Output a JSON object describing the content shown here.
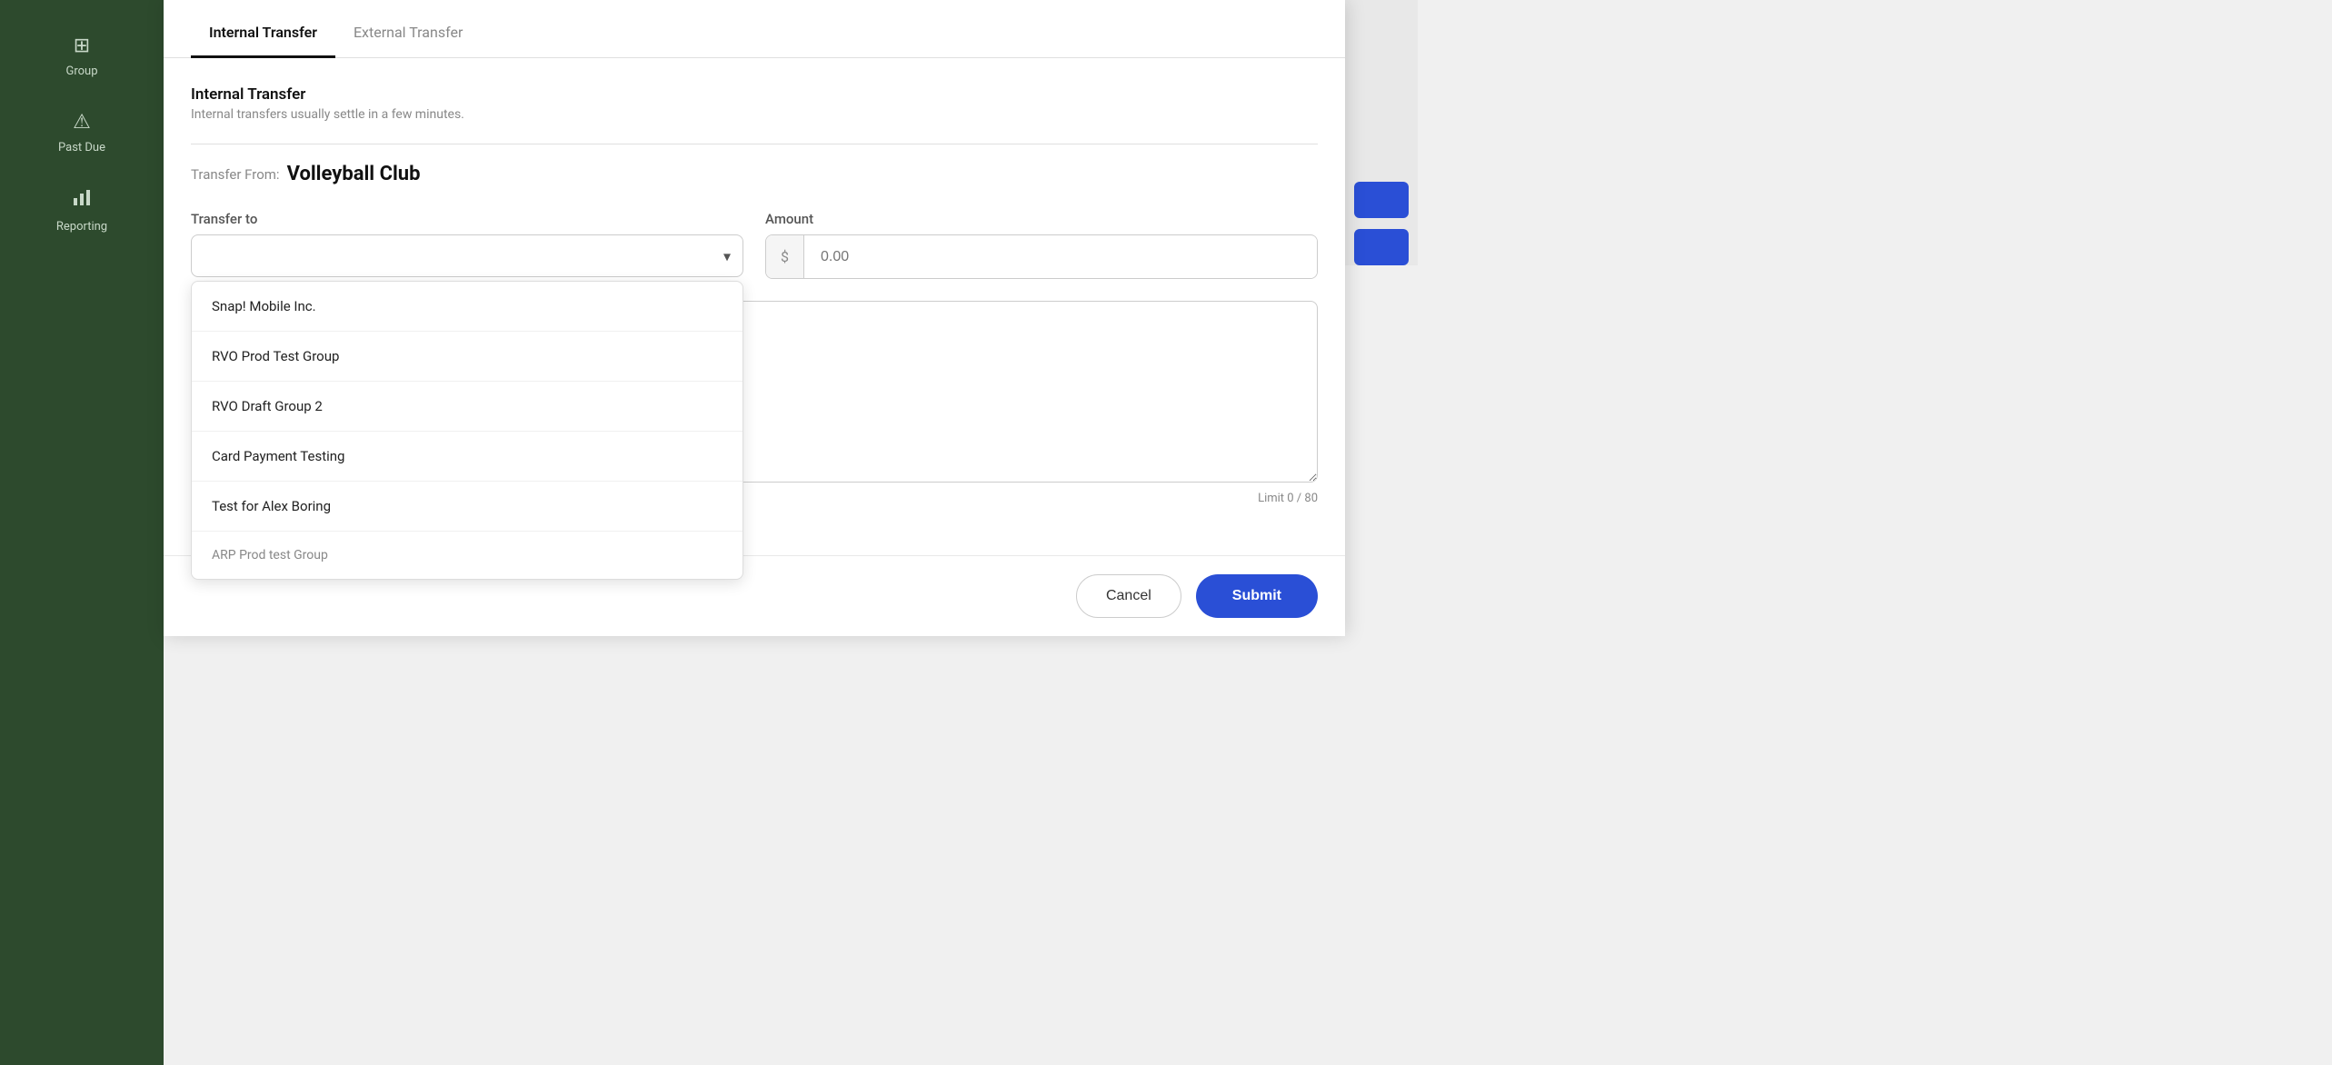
{
  "sidebar": {
    "items": [
      {
        "id": "group",
        "label": "Group",
        "icon": "⊞"
      },
      {
        "id": "past-due",
        "label": "Past Due",
        "icon": "⚠"
      },
      {
        "id": "reporting",
        "label": "Reporting",
        "icon": "📊"
      }
    ]
  },
  "modal": {
    "tabs": [
      {
        "id": "internal",
        "label": "Internal Transfer",
        "active": true
      },
      {
        "id": "external",
        "label": "External Transfer",
        "active": false
      }
    ],
    "section_title": "Internal Transfer",
    "section_subtitle": "Internal transfers usually settle in a few minutes.",
    "transfer_from_label": "Transfer From:",
    "transfer_from_value": "Volleyball Club",
    "transfer_to_label": "Transfer to",
    "transfer_to_placeholder": "",
    "amount_label": "Amount",
    "amount_placeholder": "0.00",
    "amount_prefix": "$",
    "dropdown_items": [
      {
        "id": "snap-mobile",
        "label": "Snap! Mobile Inc."
      },
      {
        "id": "rvo-prod",
        "label": "RVO Prod Test Group"
      },
      {
        "id": "rvo-draft",
        "label": "RVO Draft Group 2"
      },
      {
        "id": "card-payment",
        "label": "Card Payment Testing"
      },
      {
        "id": "test-alex",
        "label": "Test for Alex Boring"
      },
      {
        "id": "arp-prod",
        "label": "ARP Prod test Group"
      }
    ],
    "char_limit_label": "Limit 0 / 80",
    "cancel_label": "Cancel",
    "submit_label": "Submit"
  }
}
